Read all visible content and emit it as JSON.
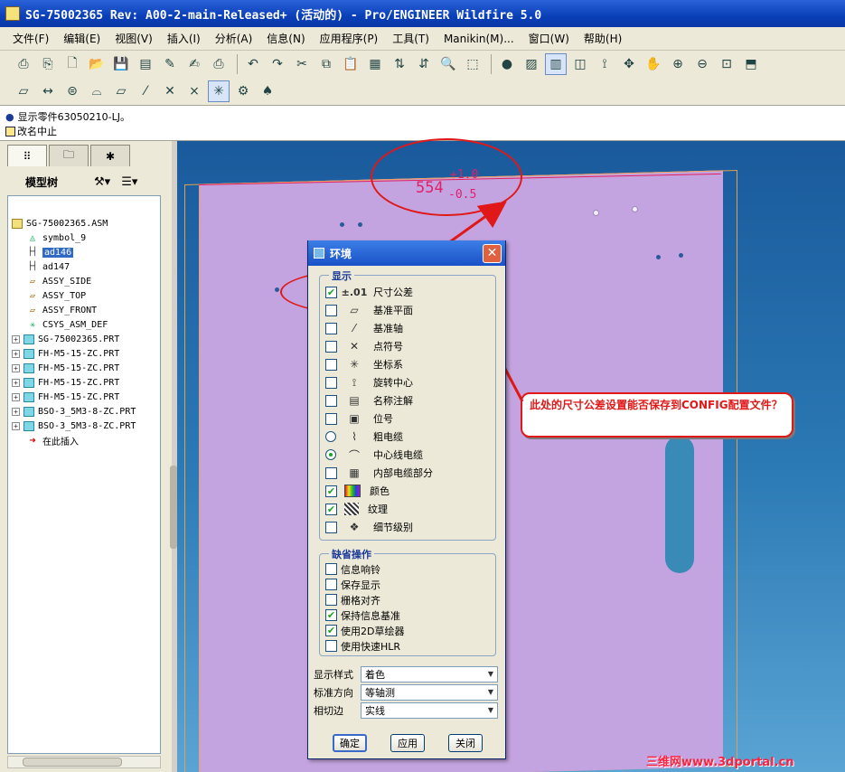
{
  "window": {
    "title": "SG-75002365 Rev: A00-2-main-Released+ (活动的) - Pro/ENGINEER Wildfire 5.0"
  },
  "menu": [
    "文件(F)",
    "编辑(E)",
    "视图(V)",
    "插入(I)",
    "分析(A)",
    "信息(N)",
    "应用程序(P)",
    "工具(T)",
    "Manikin(M)...",
    "窗口(W)",
    "帮助(H)"
  ],
  "message_area": {
    "line1": "显示零件63050210-LJ。",
    "line2": "改名中止"
  },
  "left_panel": {
    "title": "模型树",
    "tree": [
      {
        "label": "SG-75002365.ASM",
        "icon": "assembly-icon",
        "expand": false,
        "indent": 0
      },
      {
        "label": "symbol_9",
        "icon": "symbol-icon",
        "expand": false,
        "indent": 1
      },
      {
        "label": "ad146",
        "icon": "dimension-icon",
        "expand": false,
        "indent": 1,
        "selected": true
      },
      {
        "label": "ad147",
        "icon": "dimension-icon",
        "expand": false,
        "indent": 1
      },
      {
        "label": "ASSY_SIDE",
        "icon": "datum-plane-icon",
        "expand": false,
        "indent": 1
      },
      {
        "label": "ASSY_TOP",
        "icon": "datum-plane-icon",
        "expand": false,
        "indent": 1
      },
      {
        "label": "ASSY_FRONT",
        "icon": "datum-plane-icon",
        "expand": false,
        "indent": 1
      },
      {
        "label": "CSYS_ASM_DEF",
        "icon": "csys-icon",
        "expand": false,
        "indent": 1
      },
      {
        "label": "SG-75002365.PRT",
        "icon": "part-icon",
        "expand": true,
        "indent": 0
      },
      {
        "label": "FH-M5-15-ZC.PRT",
        "icon": "part-icon",
        "expand": true,
        "indent": 0
      },
      {
        "label": "FH-M5-15-ZC.PRT",
        "icon": "part-icon",
        "expand": true,
        "indent": 0
      },
      {
        "label": "FH-M5-15-ZC.PRT",
        "icon": "part-icon",
        "expand": true,
        "indent": 0
      },
      {
        "label": "FH-M5-15-ZC.PRT",
        "icon": "part-icon",
        "expand": true,
        "indent": 0
      },
      {
        "label": "BSO-3_5M3-8-ZC.PRT",
        "icon": "part-icon",
        "expand": true,
        "indent": 0
      },
      {
        "label": "BSO-3_5M3-8-ZC.PRT",
        "icon": "part-icon",
        "expand": true,
        "indent": 0
      },
      {
        "label": "在此插入",
        "icon": "insert-arrow-icon",
        "expand": false,
        "indent": 1
      }
    ]
  },
  "graphics": {
    "dimension_value": "554",
    "tol_upper": "+1.0",
    "tol_lower": "-0.5"
  },
  "callout": {
    "text": "此处的尺寸公差设置能否保存到CONFIG配置文件？"
  },
  "watermark": "三维网www.3dportal.cn",
  "dialog": {
    "title": "环境",
    "display_group_label": "显示",
    "display_items": [
      {
        "label": "尺寸公差",
        "type": "checkbox",
        "checked": true,
        "icon": "tolerance-icon",
        "icon_text": "±.01"
      },
      {
        "label": "基准平面",
        "type": "checkbox",
        "checked": false,
        "icon": "datum-plane-icon",
        "icon_text": "▱"
      },
      {
        "label": "基准轴",
        "type": "checkbox",
        "checked": false,
        "icon": "datum-axis-icon",
        "icon_text": "⁄"
      },
      {
        "label": "点符号",
        "type": "checkbox",
        "checked": false,
        "icon": "point-icon",
        "icon_text": "✕"
      },
      {
        "label": "坐标系",
        "type": "checkbox",
        "checked": false,
        "icon": "csys-icon",
        "icon_text": "✳"
      },
      {
        "label": "旋转中心",
        "type": "checkbox",
        "checked": false,
        "icon": "spin-center-icon",
        "icon_text": "⟟"
      },
      {
        "label": "名称注解",
        "type": "checkbox",
        "checked": false,
        "icon": "name-note-icon",
        "icon_text": "▤"
      },
      {
        "label": "位号",
        "type": "checkbox",
        "checked": false,
        "icon": "tag-icon",
        "icon_text": "▣"
      },
      {
        "label": "粗电缆",
        "type": "radio",
        "checked": false,
        "icon": "thick-cable-icon",
        "icon_text": "⌇"
      },
      {
        "label": "中心线电缆",
        "type": "radio",
        "checked": true,
        "icon": "centerline-cable-icon",
        "icon_text": "⌒"
      },
      {
        "label": "内部电缆部分",
        "type": "checkbox",
        "checked": false,
        "icon": "internal-cable-icon",
        "icon_text": "▦"
      },
      {
        "label": "颜色",
        "type": "checkbox",
        "checked": true,
        "icon": "colors-icon",
        "icon_text": ""
      },
      {
        "label": "纹理",
        "type": "checkbox",
        "checked": true,
        "icon": "texture-icon",
        "icon_text": ""
      },
      {
        "label": "细节级别",
        "type": "checkbox",
        "checked": false,
        "icon": "detail-level-icon",
        "icon_text": "❖"
      }
    ],
    "default_group_label": "缺省操作",
    "default_items": [
      {
        "label": "信息响铃",
        "checked": false
      },
      {
        "label": "保存显示",
        "checked": false
      },
      {
        "label": "栅格对齐",
        "checked": false
      },
      {
        "label": "保持信息基准",
        "checked": true
      },
      {
        "label": "使用2D草绘器",
        "checked": true
      },
      {
        "label": "使用快速HLR",
        "checked": false
      }
    ],
    "display_style": {
      "label": "显示样式",
      "value": "着色"
    },
    "standard_orient": {
      "label": "标准方向",
      "value": "等轴测"
    },
    "tangent_edges": {
      "label": "相切边",
      "value": "实线"
    },
    "buttons": {
      "ok": "确定",
      "apply": "应用",
      "close": "关闭"
    }
  }
}
